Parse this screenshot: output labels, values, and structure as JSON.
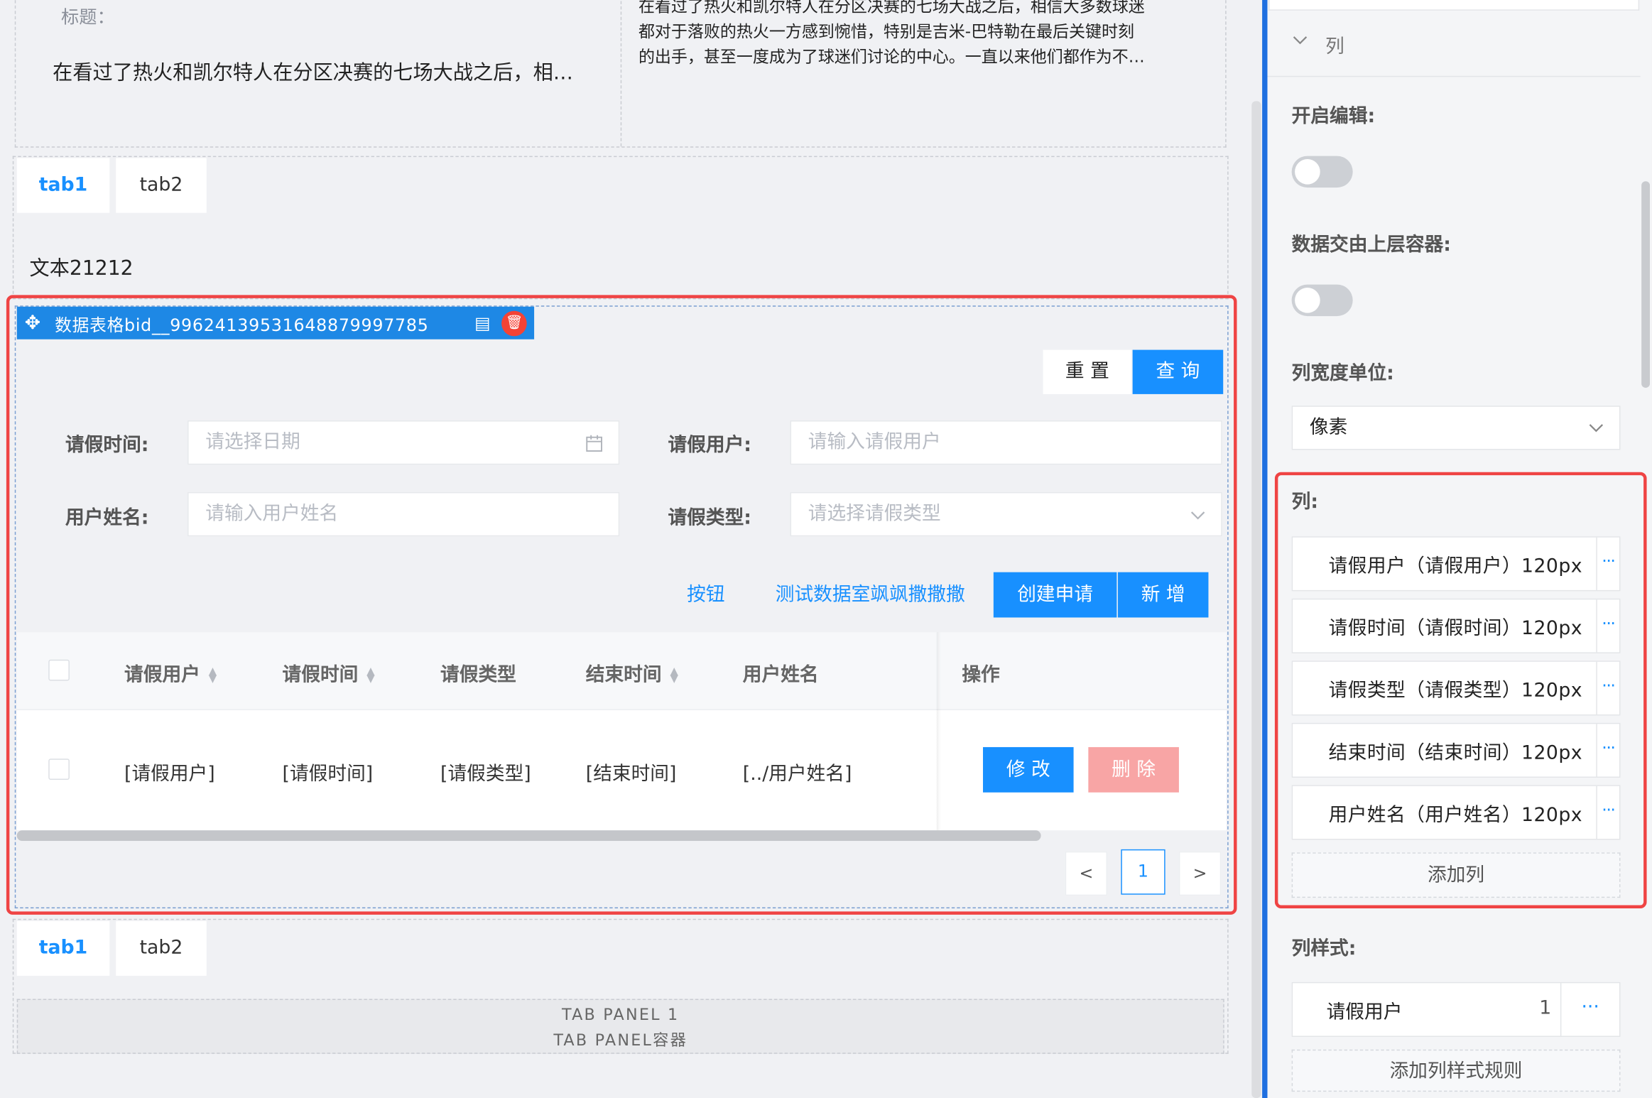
{
  "article": {
    "label": "标题：",
    "title": "在看过了热火和凯尔特人在分区决赛的七场大战之后，相…",
    "paragraph_lines": [
      "在看过了热火和凯尔特人在分区决赛的七场大战之后，相信大多数球迷",
      "都对于落败的热火一方感到惋惜，特别是吉米-巴特勒在最后关键时刻",
      "的出手，甚至一度成为了球迷们讨论的中心。一直以来他们都作为不…"
    ]
  },
  "tabs_top": [
    "tab1",
    "tab2"
  ],
  "text_component": "文本21212",
  "component_tag": {
    "move_icon": "move-icon",
    "name": "数据表格bid__99624139531648879997785",
    "copy_icon": "copy-icon",
    "delete_icon": "trash-icon"
  },
  "search": {
    "reset_label": "重 置",
    "query_label": "查 询",
    "fields": [
      {
        "label": "请假时间:",
        "placeholder": "请选择日期",
        "suffix": "calendar-icon"
      },
      {
        "label": "请假用户:",
        "placeholder": "请输入请假用户"
      },
      {
        "label": "用户姓名:",
        "placeholder": "请输入用户姓名"
      },
      {
        "label": "请假类型:",
        "placeholder": "请选择请假类型",
        "suffix": "chevron-down-icon"
      }
    ]
  },
  "toolbar": {
    "link1": "按钮",
    "link2": "测试数据室飒飒撒撒撒",
    "create_label": "创建申请",
    "add_label": "新 增"
  },
  "table": {
    "headers": [
      "请假用户",
      "请假时间",
      "请假类型",
      "结束时间",
      "用户姓名",
      "操作"
    ],
    "sortable": [
      true,
      true,
      false,
      true,
      false,
      false
    ],
    "row": [
      "[请假用户]",
      "[请假时间]",
      "[请假类型]",
      "[结束时间]",
      "[../用户姓名]"
    ],
    "edit_label": "修 改",
    "delete_label": "删 除"
  },
  "pagination": {
    "prev": "<",
    "current": "1",
    "next": ">"
  },
  "tabs_bottom": [
    "tab1",
    "tab2"
  ],
  "tab_panel": {
    "line1": "TAB PANEL 1",
    "line2": "TAB PANEL容器"
  },
  "right_panel": {
    "section_title": "列",
    "enable_edit_label": "开启编辑:",
    "data_to_parent_label": "数据交由上层容器:",
    "width_unit_label": "列宽度单位:",
    "width_unit_value": "像素",
    "columns_label": "列:",
    "columns": [
      "请假用户（请假用户）120px",
      "请假时间（请假时间）120px",
      "请假类型（请假类型）120px",
      "结束时间（结束时间）120px",
      "用户姓名（用户姓名）120px"
    ],
    "add_column_label": "添加列",
    "column_style_label": "列样式:",
    "style_rule_name": "请假用户",
    "style_rule_count": "1",
    "add_style_rule_label": "添加列样式规则"
  },
  "colors": {
    "accent": "#1890ff",
    "selection_red": "#ef4444",
    "danger_light": "#f8a5a5",
    "tag_blue": "#1e88e5"
  }
}
